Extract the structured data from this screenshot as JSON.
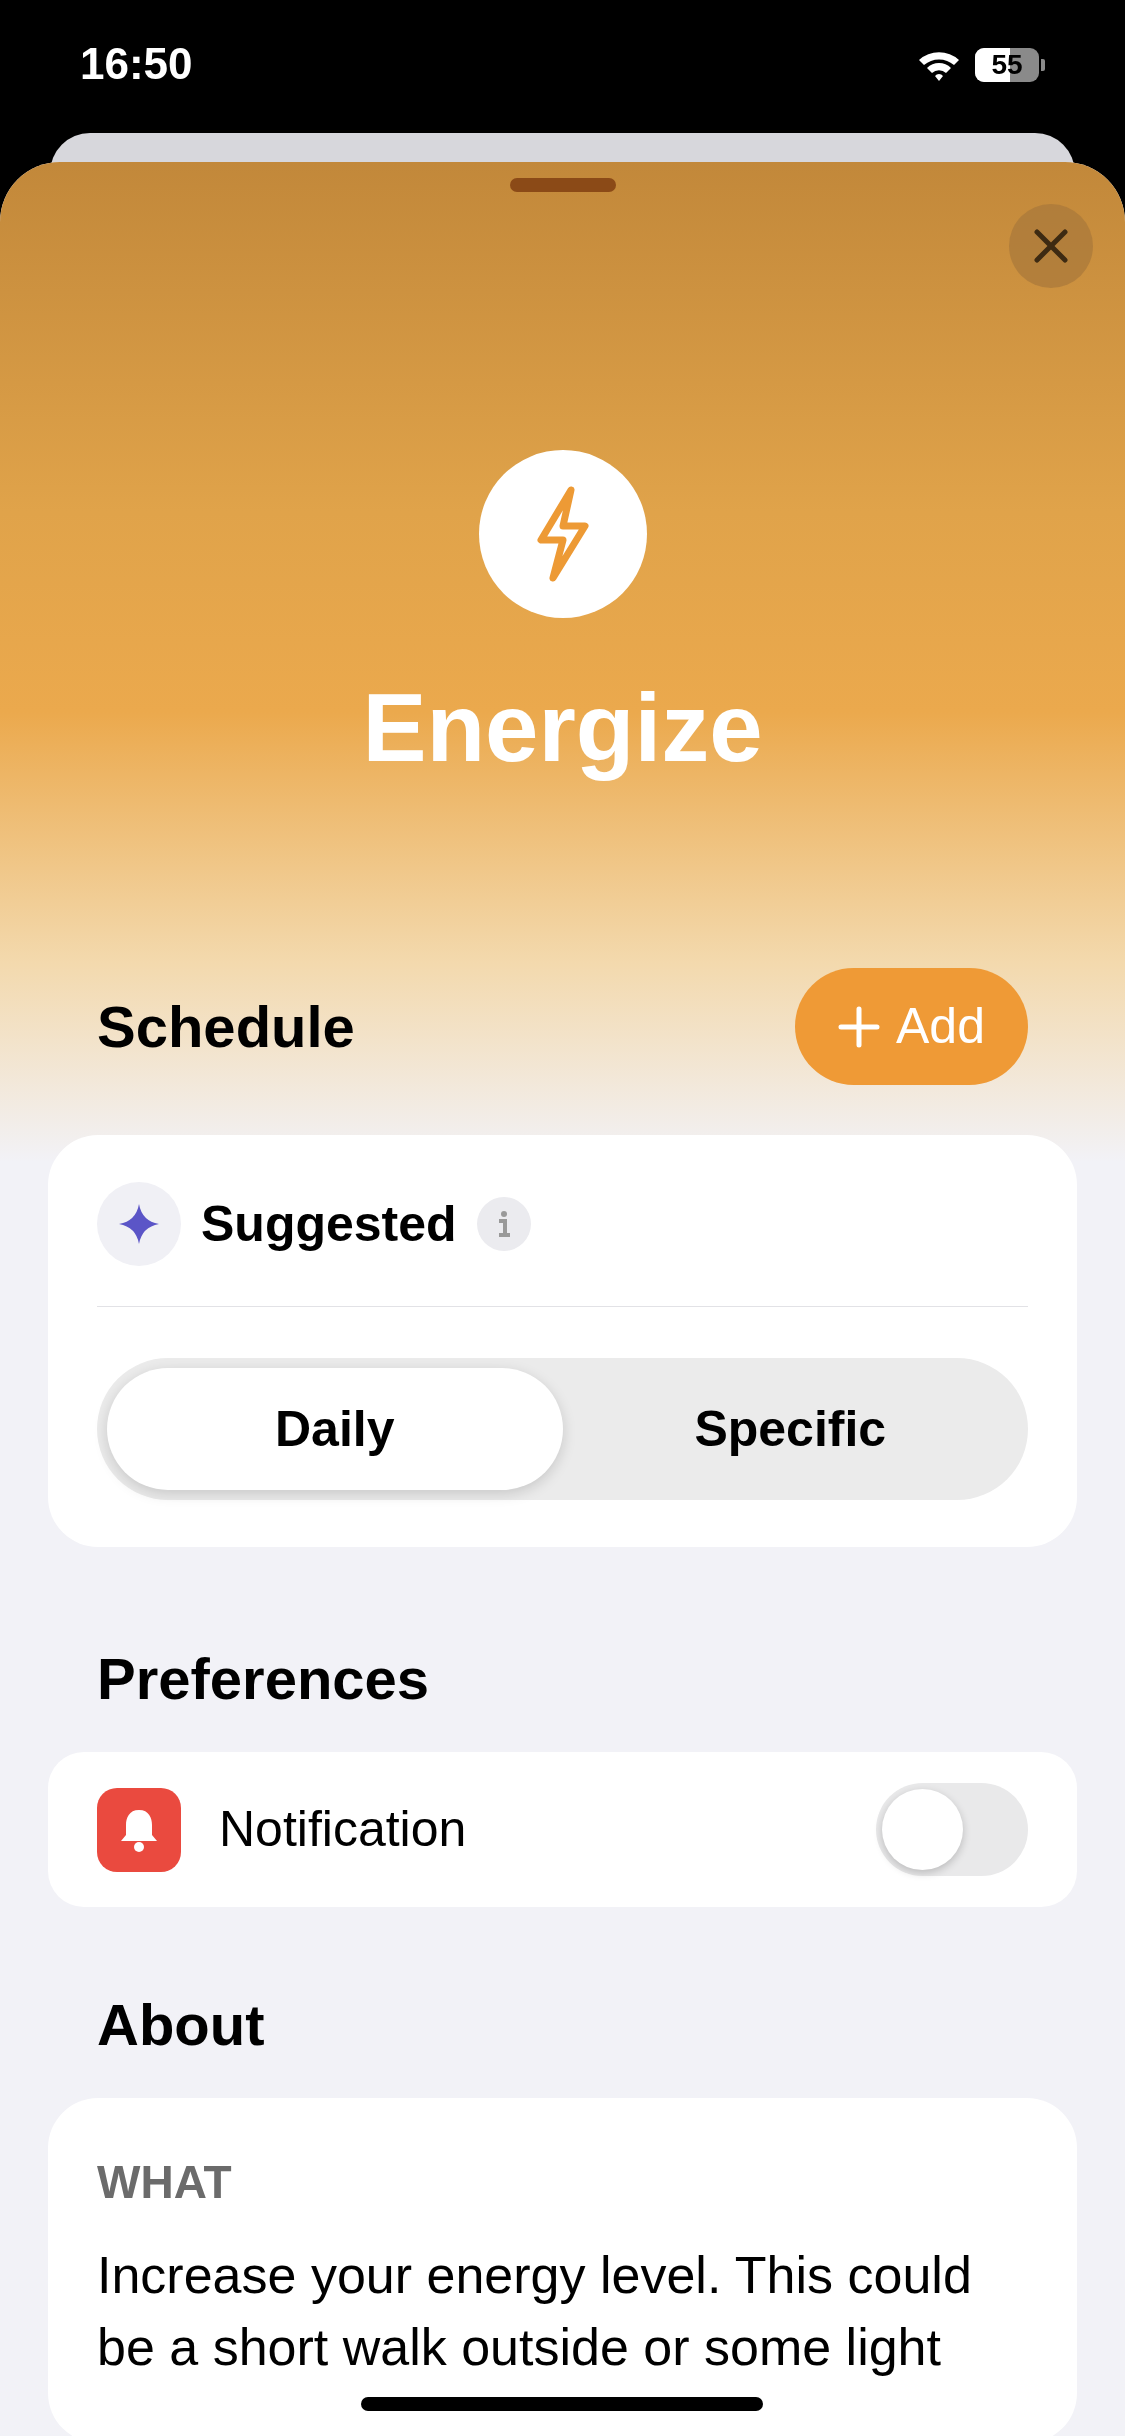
{
  "status_bar": {
    "time": "16:50",
    "battery": "55"
  },
  "header": {
    "title": "Energize"
  },
  "schedule": {
    "heading": "Schedule",
    "add_button": "Add",
    "suggested": "Suggested",
    "segments": [
      {
        "label": "Daily",
        "selected": true
      },
      {
        "label": "Specific",
        "selected": false
      }
    ]
  },
  "preferences": {
    "heading": "Preferences",
    "items": [
      {
        "label": "Notification",
        "on": false
      }
    ]
  },
  "about": {
    "heading": "About",
    "section_label": "WHAT",
    "text": "Increase your energy level. This could be a short walk outside or some light"
  }
}
